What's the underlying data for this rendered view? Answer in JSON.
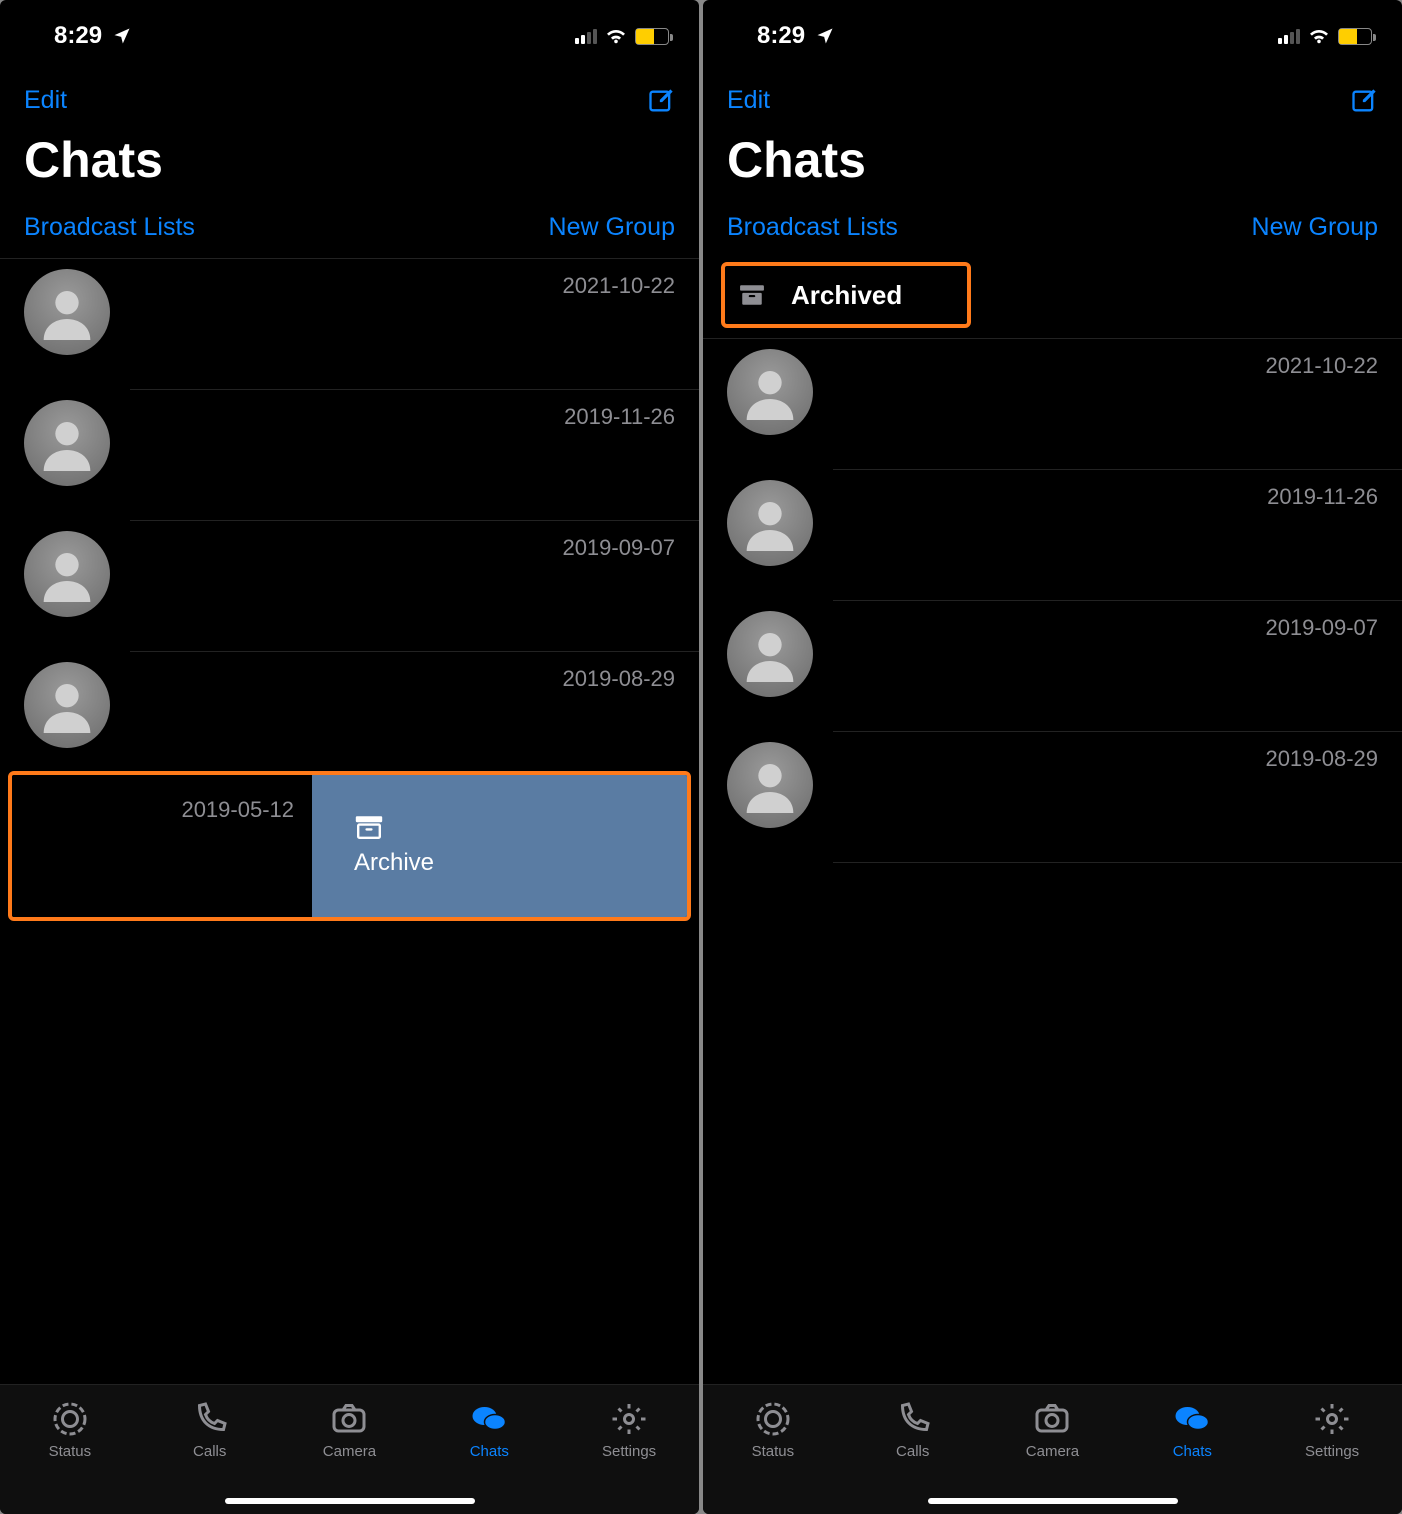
{
  "status": {
    "time": "8:29"
  },
  "nav": {
    "edit": "Edit"
  },
  "title": "Chats",
  "sublinks": {
    "broadcast": "Broadcast Lists",
    "newgroup": "New Group"
  },
  "left": {
    "chats": [
      {
        "date": "2021-10-22"
      },
      {
        "date": "2019-11-26"
      },
      {
        "date": "2019-09-07"
      },
      {
        "date": "2019-08-29"
      }
    ],
    "swipe": {
      "date": "2019-05-12",
      "action": "Archive"
    }
  },
  "right": {
    "archived": "Archived",
    "chats": [
      {
        "date": "2021-10-22"
      },
      {
        "date": "2019-11-26"
      },
      {
        "date": "2019-09-07"
      },
      {
        "date": "2019-08-29"
      }
    ]
  },
  "tabs": {
    "status": "Status",
    "calls": "Calls",
    "camera": "Camera",
    "chats": "Chats",
    "settings": "Settings"
  }
}
